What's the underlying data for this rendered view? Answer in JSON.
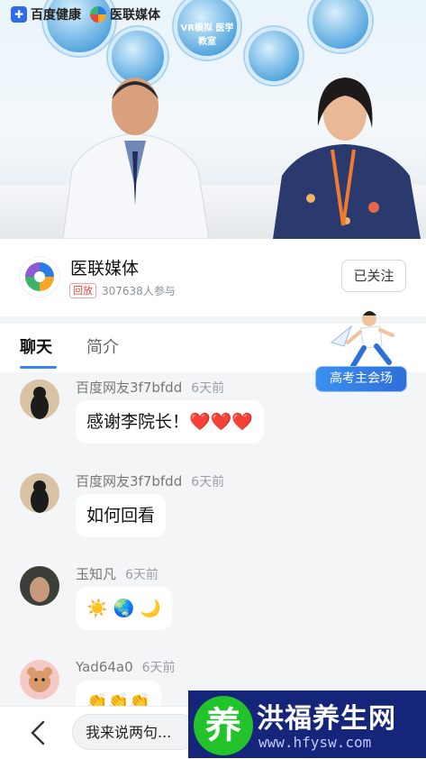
{
  "video": {
    "brand_baidu": "百度健康",
    "brand_yilian": "医联媒体",
    "poster_label": "VR模拟 医学教室"
  },
  "channel": {
    "name": "医联媒体",
    "replay_tag": "回放",
    "participants": "307638人参与",
    "follow_label": "已关注"
  },
  "tabs": {
    "chat": "聊天",
    "intro": "简介"
  },
  "promo": {
    "label": "高考主会场"
  },
  "messages": [
    {
      "user": "百度网友3f7bfdd",
      "time": "6天前",
      "text": "感谢李院长！❤️❤️❤️"
    },
    {
      "user": "百度网友3f7bfdd",
      "time": "6天前",
      "text": "如何回看"
    },
    {
      "user": "玉知凡",
      "time": "6天前",
      "text": "☀️ 🌏 🌙"
    },
    {
      "user": "Yad64a0",
      "time": "6天前",
      "text": "👏👏👏"
    }
  ],
  "composer": {
    "placeholder": "我来说两句..."
  },
  "watermark": {
    "icon_char": "养",
    "title": "洪福养生网",
    "url": "www.hfysw.com"
  }
}
